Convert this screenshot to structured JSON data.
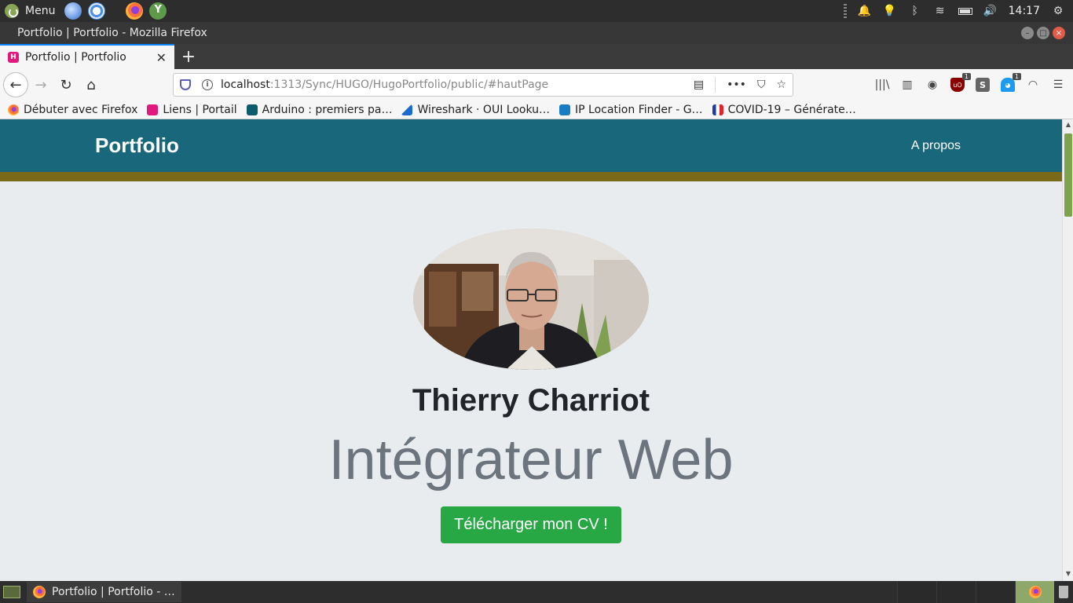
{
  "os": {
    "menu_label": "Menu",
    "clock": "14:17",
    "launchers": [
      "thunderbird-icon",
      "chromium-icon",
      "firefox-icon",
      "yt-downloader-icon"
    ]
  },
  "window": {
    "title": "Portfolio | Portfolio - Mozilla Firefox",
    "controls": {
      "minimize": "–",
      "maximize": "□",
      "close": "×"
    }
  },
  "tabs": [
    {
      "label": "Portfolio | Portfolio",
      "active": true
    }
  ],
  "url_bar": {
    "host": "localhost",
    "path": ":1313/Sync/HUGO/HugoPortfolio/public/#hautPage"
  },
  "bookmarks": [
    {
      "label": "Débuter avec Firefox",
      "icon": "firefox-icon"
    },
    {
      "label": "Liens | Portail",
      "icon": "hugo-icon"
    },
    {
      "label": "Arduino : premiers pa…",
      "icon": "arduino-icon"
    },
    {
      "label": "Wireshark · OUI Looku…",
      "icon": "wireshark-icon"
    },
    {
      "label": "IP Location Finder - G…",
      "icon": "ip-location-icon"
    },
    {
      "label": "COVID-19 – Générate…",
      "icon": "gouv-icon"
    }
  ],
  "toolbar": {
    "badges": {
      "ublock": "1",
      "ghostery": "1"
    }
  },
  "site": {
    "brand": "Portfolio",
    "nav_link": "A propos",
    "profile_name": "Thierry Charriot",
    "profile_role": "Intégrateur Web",
    "cv_button": "Télécharger mon CV !"
  },
  "taskbar": {
    "task_label": "Portfolio | Portfolio - …"
  },
  "colors": {
    "header": "#19677a",
    "strip": "#7c6a1b",
    "page_bg": "#e9ecef",
    "cv_button": "#28a745"
  }
}
